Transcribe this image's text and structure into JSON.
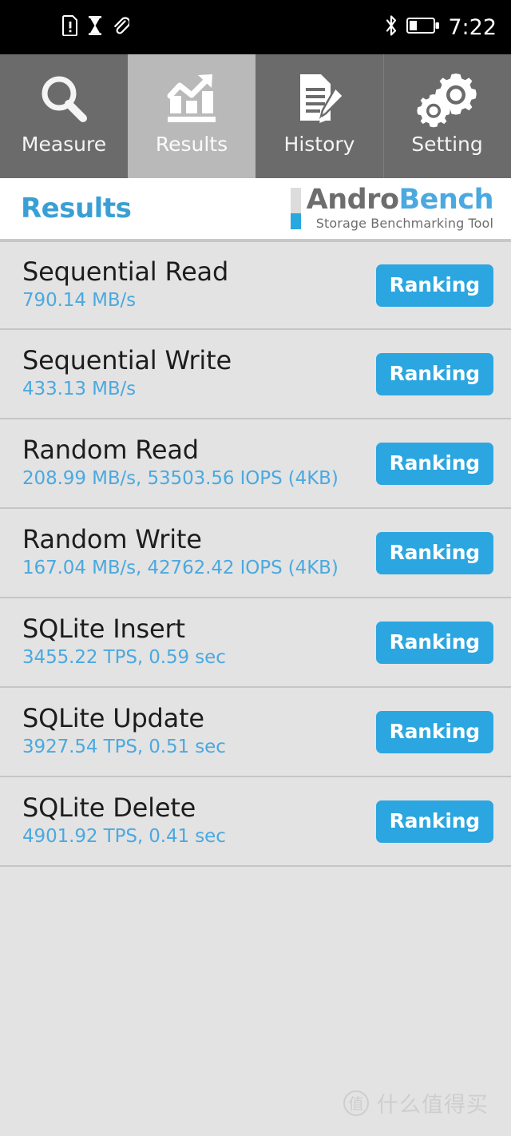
{
  "status_bar": {
    "left_icons": [
      "sim-card-alert-icon",
      "hourglass-icon",
      "attachment-icon"
    ],
    "right_icons": [
      "bluetooth-icon",
      "battery-icon"
    ],
    "clock": "7:22"
  },
  "tabs": [
    {
      "label": "Measure",
      "icon": "magnifier-icon",
      "active": false
    },
    {
      "label": "Results",
      "icon": "bar-chart-trend-icon",
      "active": true
    },
    {
      "label": "History",
      "icon": "document-pencil-icon",
      "active": false
    },
    {
      "label": "Setting",
      "icon": "gears-icon",
      "active": false
    }
  ],
  "header": {
    "page_title": "Results",
    "brand_name_part1": "Andro",
    "brand_name_part2": "Bench",
    "brand_tagline": "Storage Benchmarking Tool",
    "accent_color": "#4aa9e0",
    "brand_gray": "#6d6d6d"
  },
  "results": {
    "ranking_label": "Ranking",
    "rows": [
      {
        "title": "Sequential Read",
        "value": "790.14 MB/s"
      },
      {
        "title": "Sequential Write",
        "value": "433.13 MB/s"
      },
      {
        "title": "Random Read",
        "value": "208.99 MB/s, 53503.56 IOPS (4KB)"
      },
      {
        "title": "Random Write",
        "value": "167.04 MB/s, 42762.42 IOPS (4KB)"
      },
      {
        "title": "SQLite Insert",
        "value": "3455.22 TPS, 0.59 sec"
      },
      {
        "title": "SQLite Update",
        "value": "3927.54 TPS, 0.51 sec"
      },
      {
        "title": "SQLite Delete",
        "value": "4901.92 TPS, 0.41 sec"
      }
    ]
  },
  "watermark": {
    "badge": "值",
    "text": "什么值得买"
  }
}
